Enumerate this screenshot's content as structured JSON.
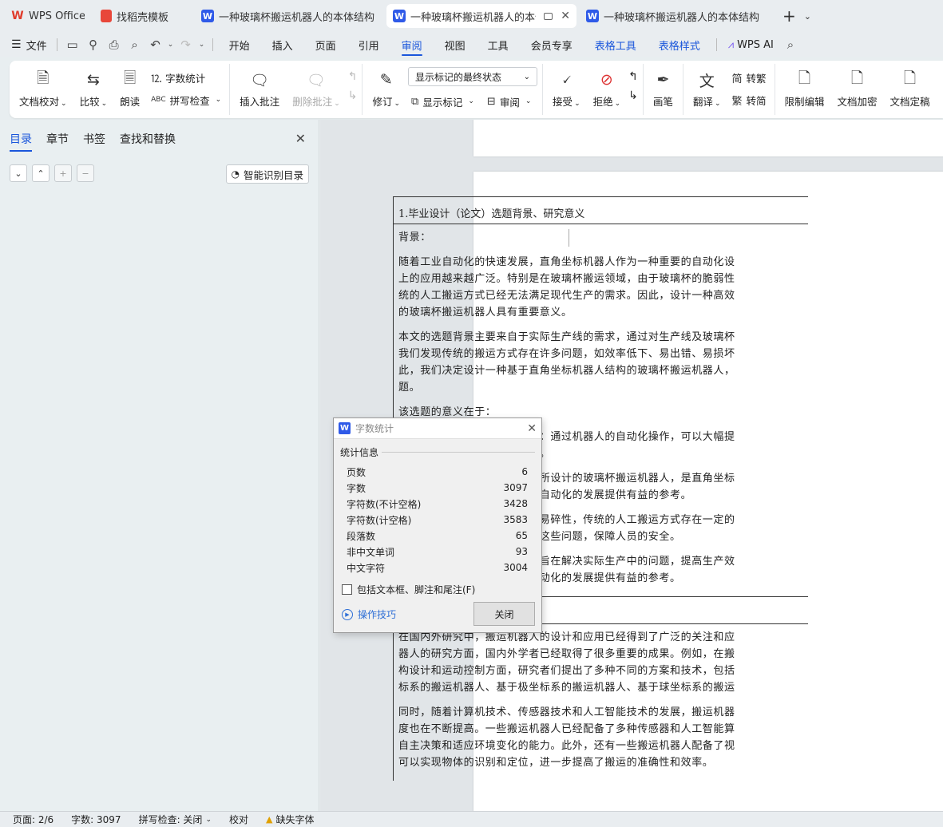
{
  "tabs": [
    {
      "label": "WPS Office",
      "icon": "wps-logo-icon"
    },
    {
      "label": "找稻壳模板",
      "icon": "docer-icon"
    },
    {
      "label": "一种玻璃杯搬运机器人的本体结构设计",
      "icon": "writer-icon"
    },
    {
      "label": "一种玻璃杯搬运机器人的本体结",
      "icon": "writer-icon",
      "active": true
    },
    {
      "label": "一种玻璃杯搬运机器人的本体结构设计",
      "icon": "writer-icon"
    }
  ],
  "menu": {
    "file": "文件",
    "items": [
      "开始",
      "插入",
      "页面",
      "引用",
      "审阅",
      "视图",
      "工具",
      "会员专享",
      "表格工具",
      "表格样式"
    ],
    "active": "审阅",
    "ai": "WPS AI"
  },
  "ribbon": {
    "proofread": "文档校对",
    "compare": "比较",
    "read_aloud": "朗读",
    "word_count": "字数统计",
    "spell_check": "拼写检查",
    "insert_comment": "插入批注",
    "delete_comment": "删除批注",
    "revise": "修订",
    "display_mode": "显示标记的最终状态",
    "show_markup": "显示标记",
    "review": "审阅",
    "accept": "接受",
    "reject": "拒绝",
    "ink": "画笔",
    "translate": "翻译",
    "to_traditional": "转繁",
    "to_simplified": "转简",
    "restrict_edit": "限制编辑",
    "encrypt": "文档加密",
    "finalize": "文档定稿"
  },
  "nav": {
    "tabs": [
      "目录",
      "章节",
      "书签",
      "查找和替换"
    ],
    "active": "目录",
    "smart_toc": "智能识别目录"
  },
  "document": {
    "section1_title": "1.毕业设计（论文）选题背景、研究意义",
    "section1_paragraphs": [
      [
        "背景："
      ],
      [
        "随着工业自动化的快速发展，直角坐标机器人作为一种重要的自动化设",
        "上的应用越来越广泛。特别是在玻璃杯搬运领域，由于玻璃杯的脆弱性",
        "统的人工搬运方式已经无法满足现代生产的需求。因此，设计一种高效",
        "的玻璃杯搬运机器人具有重要意义。"
      ],
      [
        "本文的选题背景主要来自于实际生产线的需求，通过对生产线及玻璃杯",
        "我们发现传统的搬运方式存在许多问题，如效率低下、易出错、易损坏",
        "此，我们决定设计一种基于直角坐标机器人结构的玻璃杯搬运机器人，",
        "题。"
      ],
      [
        "该选题的意义在于："
      ],
      [
        "提高玻璃杯搬运的效率和质量：通过机器人的自动化操作，可以大幅提",
        "和质量，降低生产成本和风险。"
      ],
      [
        "促进工业自动化的发展：本文所设计的玻璃杯搬运机器人，是直角坐标",
        "应用，其研究结果可以为工业自动化的发展提供有益的参考。"
      ],
      [
        "保障人员安全：由于玻璃杯的易碎性，传统的人工搬运方式存在一定的",
        "机器人的自动化操作可以避免这些问题，保障人员的安全。"
      ],
      [
        "总之，本文的选题背景及意义旨在解决实际生产中的问题，提高生产效",
        "时降低成本和风险，为工业自动化的发展提供有益的参考。"
      ]
    ],
    "section2_title": "2.国内外研究现状和发展趋势",
    "section2_paragraphs": [
      [
        "在国内外研究中，搬运机器人的设计和应用已经得到了广泛的关注和应",
        "器人的研究方面，国内外学者已经取得了很多重要的成果。例如，在搬",
        "构设计和运动控制方面，研究者们提出了多种不同的方案和技术，包括",
        "标系的搬运机器人、基于极坐标系的搬运机器人、基于球坐标系的搬运"
      ],
      [
        "同时，随着计算机技术、传感器技术和人工智能技术的发展，搬运机器",
        "度也在不断提高。一些搬运机器人已经配备了多种传感器和人工智能算",
        "自主决策和适应环境变化的能力。此外，还有一些搬运机器人配备了视",
        "可以实现物体的识别和定位，进一步提高了搬运的准确性和效率。"
      ]
    ]
  },
  "word_count_dialog": {
    "title": "字数统计",
    "group_label": "统计信息",
    "stats": [
      {
        "label": "页数",
        "value": "6"
      },
      {
        "label": "字数",
        "value": "3097"
      },
      {
        "label": "字符数(不计空格)",
        "value": "3428"
      },
      {
        "label": "字符数(计空格)",
        "value": "3583"
      },
      {
        "label": "段落数",
        "value": "65"
      },
      {
        "label": "非中文单词",
        "value": "93"
      },
      {
        "label": "中文字符",
        "value": "3004"
      }
    ],
    "include_label": "包括文本框、脚注和尾注(F)",
    "tips": "操作技巧",
    "close_button": "关闭"
  },
  "status": {
    "page": "页面: 2/6",
    "words": "字数: 3097",
    "spell": "拼写检查: 关闭",
    "proof": "校对",
    "missing_font": "缺失字体"
  },
  "colors": {
    "accent": "#1a56db",
    "writer_icon": "#2f5ae8",
    "wps_red": "#e03c2c"
  }
}
